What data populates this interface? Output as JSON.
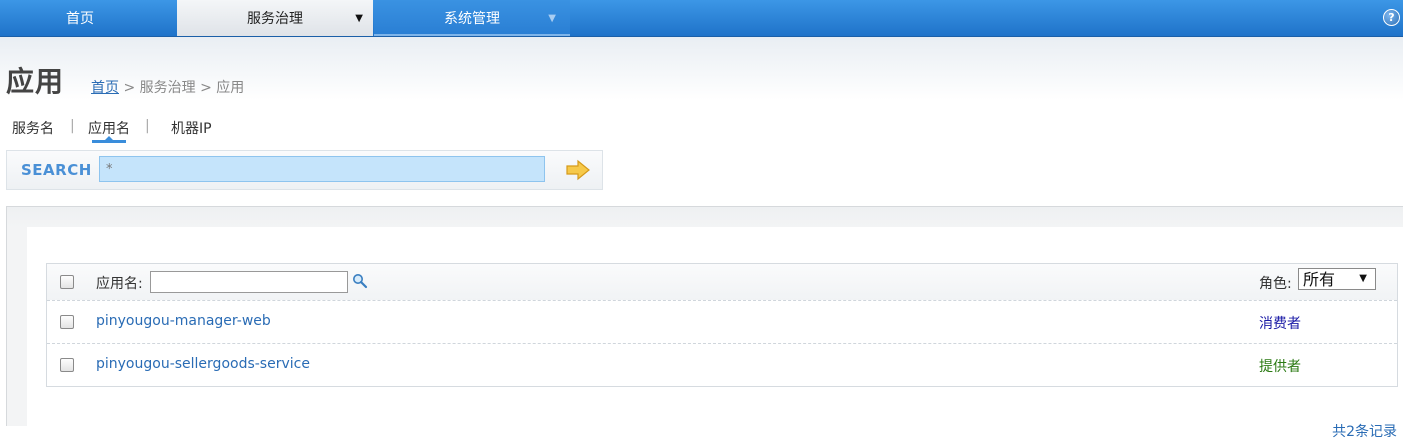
{
  "nav": {
    "home": "首页",
    "service": "服务治理",
    "system": "系统管理",
    "help": "?"
  },
  "page": {
    "title": "应用",
    "breadcrumb": {
      "home": "首页",
      "sep1": " > ",
      "service": "服务治理",
      "sep2": " > ",
      "current": "应用"
    }
  },
  "search_tabs": {
    "items": [
      "服务名",
      "应用名",
      "机器IP"
    ],
    "separator": "|",
    "active": "应用名"
  },
  "search": {
    "label": "SEARCH",
    "value": "*"
  },
  "table": {
    "header": {
      "app_label": "应用名:",
      "role_label": "角色:",
      "role_selected": "所有"
    },
    "rows": [
      {
        "app": "pinyougou-manager-web",
        "role": "消费者",
        "role_color": "#1a1aa6"
      },
      {
        "app": "pinyougou-sellergoods-service",
        "role": "提供者",
        "role_color": "#2a7a12"
      }
    ],
    "footer": "共2条记录"
  },
  "colors": {
    "nav_blue": "#2a7fd4",
    "link_blue": "#2a6cb5",
    "search_bg": "#c5e4fb"
  }
}
